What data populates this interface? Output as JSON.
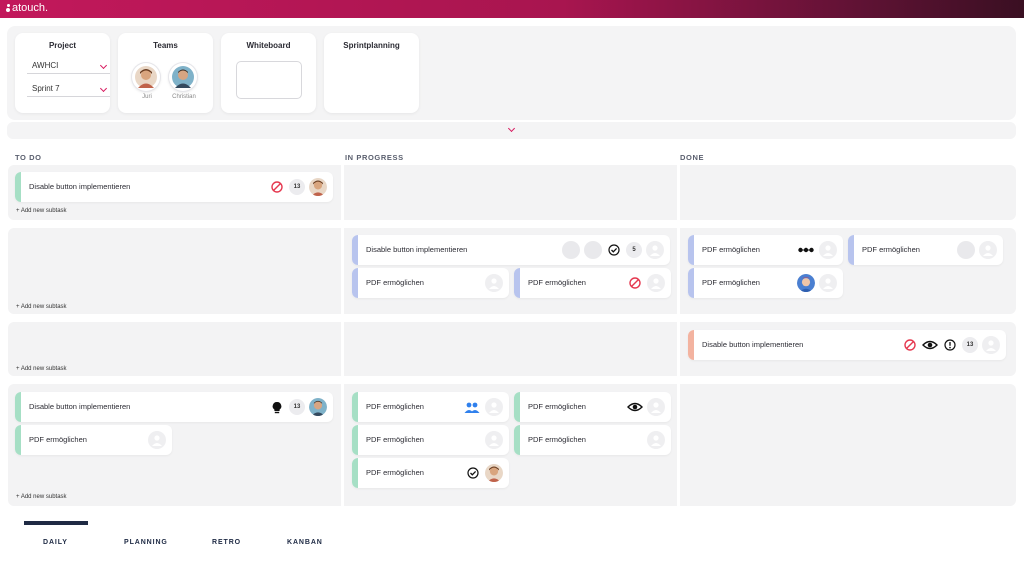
{
  "app": {
    "logo_text": "atouch."
  },
  "filters": {
    "project": {
      "title": "Project",
      "value": "AWHCI"
    },
    "sprint": {
      "value": "Sprint 7"
    },
    "teams": {
      "title": "Teams",
      "members": [
        "Juri",
        "Christian"
      ]
    },
    "whiteboard": {
      "title": "Whiteboard"
    },
    "sprintplanning": {
      "title": "Sprintplanning"
    }
  },
  "columns": [
    "TO DO",
    "IN PROGRESS",
    "DONE"
  ],
  "add_subtask": "+ Add new subtask",
  "tasks": {
    "t1": "Disable button implementieren",
    "t1_points": "13",
    "t2": "Disable button implementieren",
    "t2_points": "5",
    "t3": "PDF ermöglichen",
    "t4": "PDF ermöglichen",
    "t5": "PDF ermöglichen",
    "t6": "PDF ermöglichen",
    "t7": "PDF ermöglichen",
    "t8": "Disable button implementieren",
    "t8_points": "13",
    "t9": "Disable button implementieren",
    "t9_points": "13",
    "t10": "PDF ermöglichen",
    "t11": "PDF ermöglichen",
    "t12": "PDF ermöglichen",
    "t13": "PDF ermöglichen",
    "t14": "PDF ermöglichen",
    "t15": "PDF ermöglichen"
  },
  "tabs": [
    "DAILY",
    "PLANNING",
    "RETRO",
    "KANBAN"
  ],
  "active_tab": "DAILY",
  "colors": {
    "accent": "#d81b60",
    "green": "#a6dfc5",
    "blue": "#b8c4ee",
    "salmon": "#f3b3a0",
    "navy": "#1f2a44"
  },
  "icons": [
    "blocked-icon",
    "check-circle-icon",
    "more-dots-icon",
    "eye-icon",
    "alert-icon",
    "lightbulb-icon",
    "people-icon",
    "user-placeholder-icon"
  ]
}
